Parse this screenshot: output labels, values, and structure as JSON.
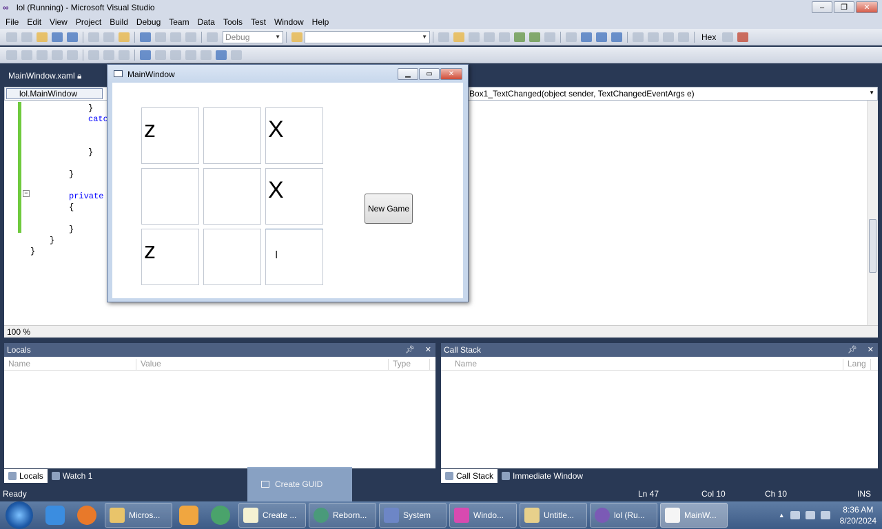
{
  "vs": {
    "title": "lol (Running) - Microsoft Visual Studio",
    "menu": [
      "File",
      "Edit",
      "View",
      "Project",
      "Build",
      "Debug",
      "Team",
      "Data",
      "Tools",
      "Test",
      "Window",
      "Help"
    ],
    "config_combo": "Debug",
    "hex_label": "Hex",
    "doc_tab": "MainWindow.xaml",
    "nav_left": "lol.MainWindow",
    "nav_right": "Box1_TextChanged(object sender, TextChangedEventArgs e)",
    "code_lines": [
      "}",
      "catc",
      "}",
      "}",
      "private",
      "{",
      "}",
      "}",
      "}"
    ],
    "zoom": "100 %"
  },
  "locals": {
    "title": "Locals",
    "cols": [
      "Name",
      "Value",
      "Type"
    ]
  },
  "callstack": {
    "title": "Call Stack",
    "cols": [
      "Name",
      "Lang"
    ]
  },
  "bottom_tabs_left": [
    "Locals",
    "Watch 1"
  ],
  "bottom_tabs_right": [
    "Call Stack",
    "Immediate Window"
  ],
  "status": {
    "ready": "Ready",
    "ln": "Ln 47",
    "col": "Col 10",
    "ch": "Ch 10",
    "ins": "INS"
  },
  "guid_popup": "Create GUID",
  "app": {
    "title": "MainWindow",
    "cells": [
      "z",
      "",
      "X",
      "",
      "",
      "X",
      "z",
      "",
      ""
    ],
    "new_game": "New Game"
  },
  "taskbar": {
    "tasks": [
      "Micros...",
      "Create ...",
      "Reborn...",
      "System",
      "Windo...",
      "Untitle...",
      "lol (Ru...",
      "MainW..."
    ],
    "time": "8:36 AM",
    "date": "8/20/2024"
  }
}
